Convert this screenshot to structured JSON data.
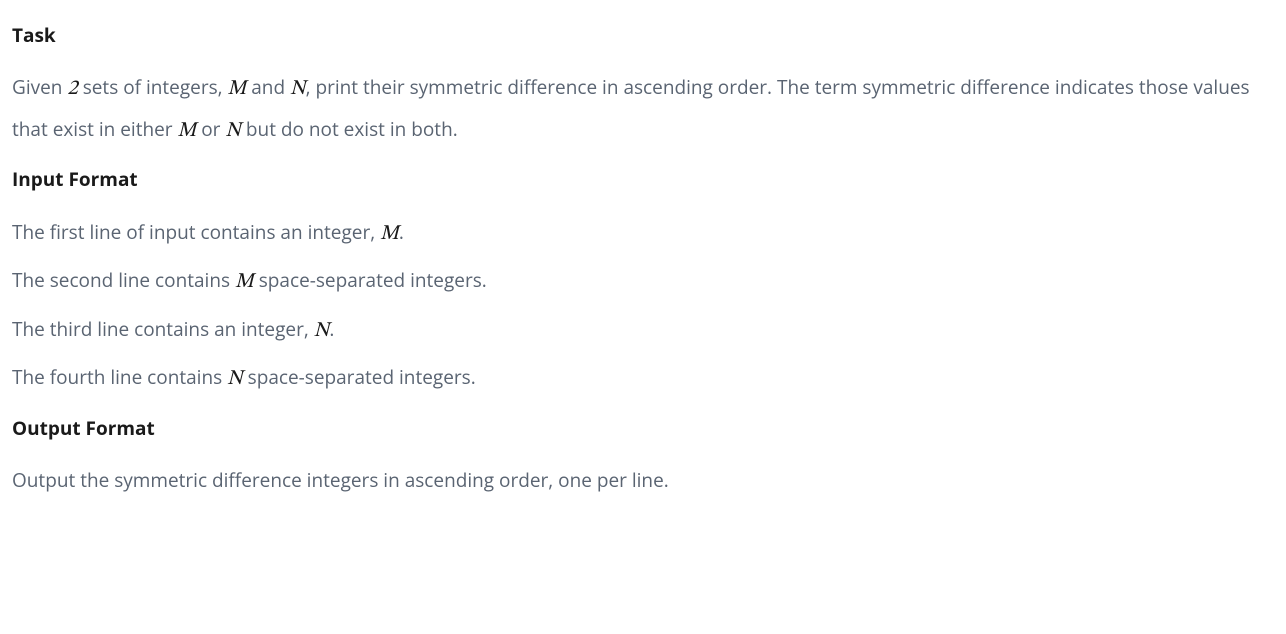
{
  "task": {
    "heading": "Task",
    "text_parts": {
      "t1": "Given ",
      "m1": "2",
      "t2": " sets of integers, ",
      "m2": "M",
      "t3": " and ",
      "m3": "N",
      "t4": ", print their symmetric difference in ascending order. The term symmetric difference indicates those values that exist in either ",
      "m4": "M",
      "t5": " or ",
      "m5": "N",
      "t6": " but do not exist in both."
    }
  },
  "input_format": {
    "heading": "Input Format",
    "lines": {
      "l1": {
        "t1": "The first line of input contains an integer, ",
        "m1": "M",
        "t2": "."
      },
      "l2": {
        "t1": "The second line contains ",
        "m1": "M",
        "t2": " space-separated integers."
      },
      "l3": {
        "t1": "The third line contains an integer, ",
        "m1": "N",
        "t2": "."
      },
      "l4": {
        "t1": "The fourth line contains ",
        "m1": "N",
        "t2": " space-separated integers."
      }
    }
  },
  "output_format": {
    "heading": "Output Format",
    "text": "Output the symmetric difference integers in ascending order, one per line."
  }
}
